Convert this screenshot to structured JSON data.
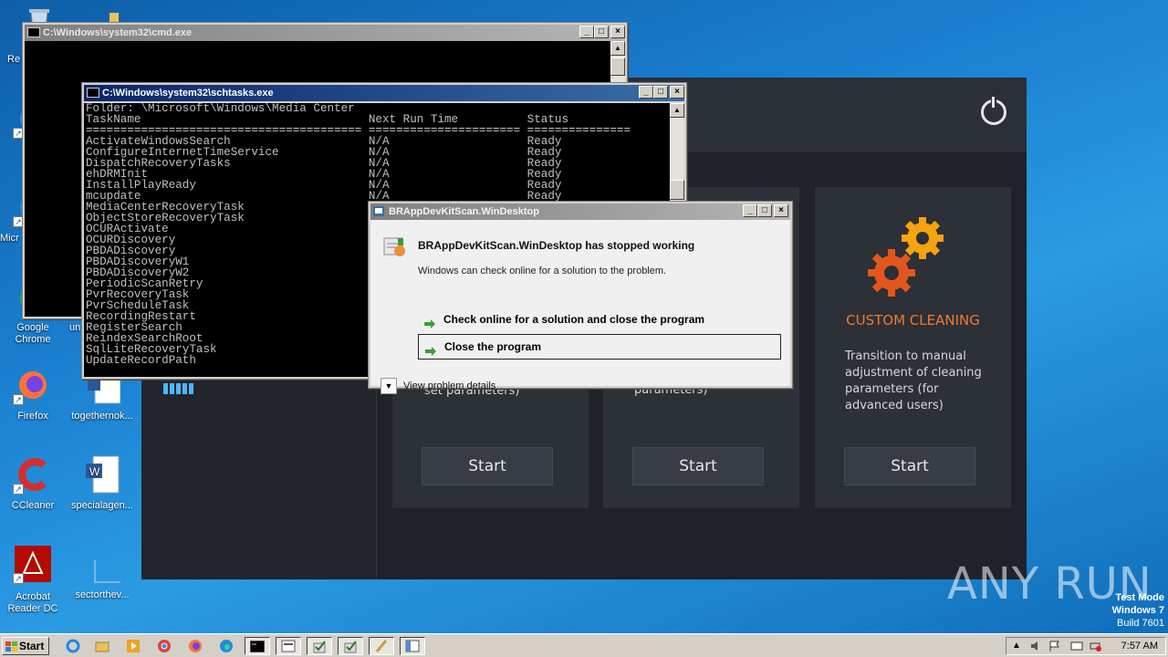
{
  "desktop": {
    "icons": [
      {
        "label": "Re"
      },
      {
        "label": "Micr"
      },
      {
        "label": "Google Chrome"
      },
      {
        "label": "un"
      },
      {
        "label": "Firefox"
      },
      {
        "label": "togethernok..."
      },
      {
        "label": "CCleaner"
      },
      {
        "label": "specialagen..."
      },
      {
        "label": "Acrobat Reader DC"
      },
      {
        "label": "sectorthev..."
      }
    ]
  },
  "cleaner_app": {
    "custom_title": "CUSTOM CLEANING",
    "custom_desc_lines": [
      "Transition to manual",
      "adjustment of cleaning",
      "parameters (for",
      "advanced users)"
    ],
    "card1_partial": "set parameters)",
    "card2_partial": "parameters)",
    "start_label": "Start",
    "accent_color": "#f07a2c"
  },
  "cmd_window": {
    "title": "C:\\Windows\\system32\\cmd.exe"
  },
  "schtasks_window": {
    "title": "C:\\Windows\\system32\\schtasks.exe",
    "lines": [
      "Folder: \\Microsoft\\Windows\\Media Center",
      "TaskName                                 Next Run Time          Status",
      "======================================== ====================== ===============",
      "ActivateWindowsSearch                    N/A                    Ready",
      "ConfigureInternetTimeService             N/A                    Ready",
      "DispatchRecoveryTasks                    N/A                    Ready",
      "ehDRMInit                                N/A                    Ready",
      "InstallPlayReady                         N/A                    Ready",
      "mcupdate                                 N/A                    Ready",
      "MediaCenterRecoveryTask",
      "ObjectStoreRecoveryTask",
      "OCURActivate",
      "OCURDiscovery",
      "PBDADiscovery",
      "PBDADiscoveryW1",
      "PBDADiscoveryW2",
      "PeriodicScanRetry",
      "PvrRecoveryTask",
      "PvrScheduleTask",
      "RecordingRestart",
      "RegisterSearch",
      "ReindexSearchRoot",
      "SqlLiteRecoveryTask",
      "UpdateRecordPath"
    ]
  },
  "error_dialog": {
    "title": "BRAppDevKitScan.WinDesktop",
    "heading": "BRAppDevKitScan.WinDesktop has stopped working",
    "subtext": "Windows can check online for a solution to the problem.",
    "option_check": "Check online for a solution and close the program",
    "option_close": "Close the program",
    "details": "View problem details"
  },
  "taskbar": {
    "start_label": "Start",
    "clock": "7:57 AM"
  },
  "watermark": {
    "logo_text": "ANY RUN",
    "mode_line1": "Test Mode",
    "mode_line2": "Windows 7",
    "mode_line3": "Build 7601"
  }
}
